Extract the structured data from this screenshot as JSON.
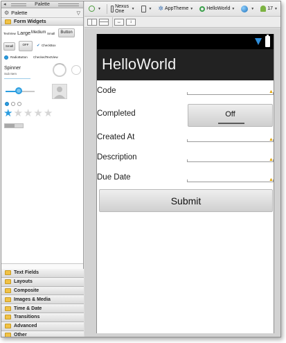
{
  "palette": {
    "window_title": "Palette",
    "header_label": "Palette",
    "form_widgets": {
      "title": "Form Widgets",
      "text_view": "TextView",
      "large": "Large",
      "medium": "Medium",
      "small": "Small",
      "button": "Button",
      "small_button": "Small",
      "toggle_off": "OFF",
      "checkbox": "CheckBox",
      "radio_button": "RadioButton",
      "checked_text_view": "CheckedTextView",
      "spinner": "Spinner",
      "spinner_sub": "Sub Item",
      "progress_value": 0.45,
      "rating_value": 1,
      "rating_max": 5
    },
    "categories": [
      "Text Fields",
      "Layouts",
      "Composite",
      "Images & Media",
      "Time & Date",
      "Transitions",
      "Advanced",
      "Other"
    ]
  },
  "toolbar": {
    "device": "Nexus One",
    "theme": "AppTheme",
    "activity": "HelloWorld",
    "api_level": "17"
  },
  "device_screen": {
    "app_title": "HelloWorld",
    "fields": {
      "code": "Code",
      "completed": "Completed",
      "created_at": "Created At",
      "description": "Description",
      "due_date": "Due Date"
    },
    "toggle_label": "Off",
    "submit_label": "Submit"
  },
  "colors": {
    "action_bar": "#222222",
    "status_bar": "#000000",
    "wifi": "#2f8fdc",
    "warning": "#e0a100",
    "folder": "#f1c246"
  },
  "icons": [
    "gear-icon",
    "folder-icon",
    "phone-icon",
    "star-icon",
    "android-icon",
    "globe-icon",
    "wifi-icon",
    "battery-icon",
    "warning-icon"
  ]
}
